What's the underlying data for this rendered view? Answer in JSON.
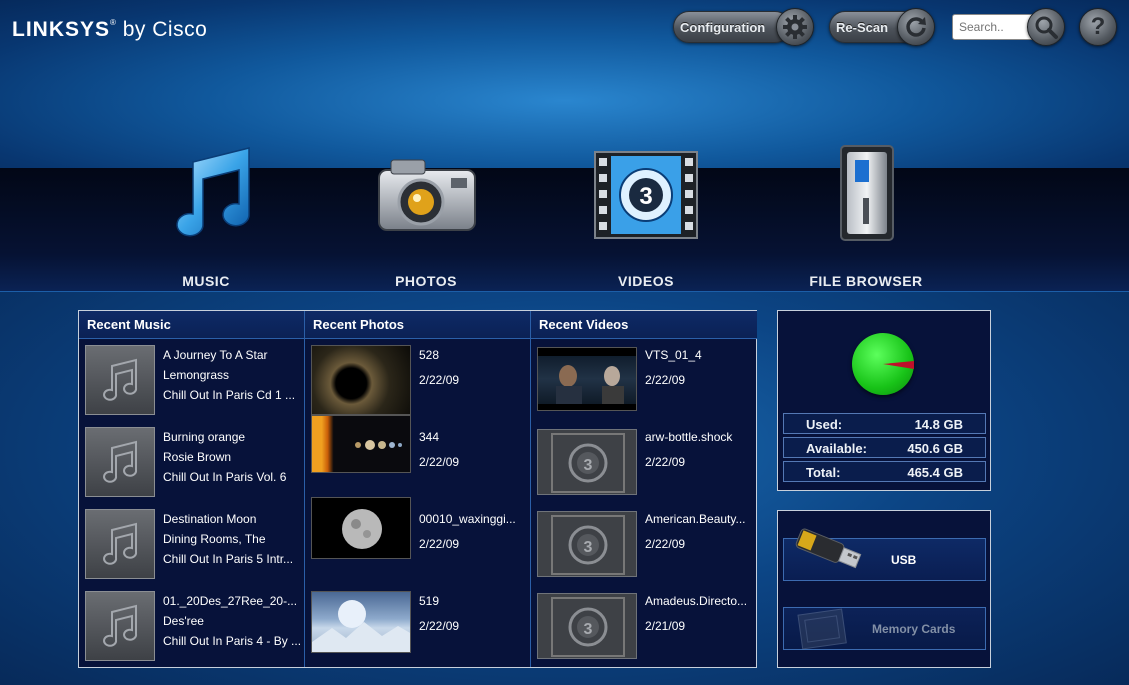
{
  "header": {
    "logo_brand": "LINKSYS",
    "logo_reg": "®",
    "logo_suffix": " by Cisco",
    "configuration_label": "Configuration",
    "rescan_label": "Re-Scan",
    "search_placeholder": "Search..",
    "help_symbol": "?"
  },
  "nav": [
    {
      "label": "MUSIC",
      "icon": "music-note-icon"
    },
    {
      "label": "PHOTOS",
      "icon": "camera-icon"
    },
    {
      "label": "VIDEOS",
      "icon": "film-countdown-icon"
    },
    {
      "label": "FILE BROWSER",
      "icon": "media-server-icon"
    }
  ],
  "recent_music": {
    "title": "Recent Music",
    "items": [
      {
        "line1": "A Journey To A Star",
        "line2": "Lemongrass",
        "line3": "Chill Out In Paris Cd 1 ..."
      },
      {
        "line1": "Burning orange",
        "line2": "Rosie Brown",
        "line3": "Chill Out In Paris Vol. 6"
      },
      {
        "line1": "Destination Moon",
        "line2": "Dining Rooms, The",
        "line3": "Chill Out In Paris 5 Intr..."
      },
      {
        "line1": "01._20Des_27Ree_20-...",
        "line2": "Des'ree",
        "line3": "Chill Out In Paris 4 - By ..."
      }
    ]
  },
  "recent_photos": {
    "title": "Recent Photos",
    "items": [
      {
        "name": "528",
        "date": "2/22/09"
      },
      {
        "name": "344",
        "date": "2/22/09"
      },
      {
        "name": "00010_waxinggi...",
        "date": "2/22/09"
      },
      {
        "name": "519",
        "date": "2/22/09"
      }
    ]
  },
  "recent_videos": {
    "title": "Recent Videos",
    "items": [
      {
        "name": "VTS_01_4",
        "date": "2/22/09"
      },
      {
        "name": "arw-bottle.shock",
        "date": "2/22/09"
      },
      {
        "name": "American.Beauty...",
        "date": "2/22/09"
      },
      {
        "name": "Amadeus.Directo...",
        "date": "2/21/09"
      }
    ]
  },
  "storage": {
    "used_label": "Used:",
    "used_value": "14.8 GB",
    "available_label": "Available:",
    "available_value": "450.6 GB",
    "total_label": "Total:",
    "total_value": "465.4 GB",
    "gauge_color": "#18c318",
    "used_color": "#c0102a"
  },
  "devices": {
    "usb_label": "USB",
    "memory_label": "Memory Cards"
  }
}
